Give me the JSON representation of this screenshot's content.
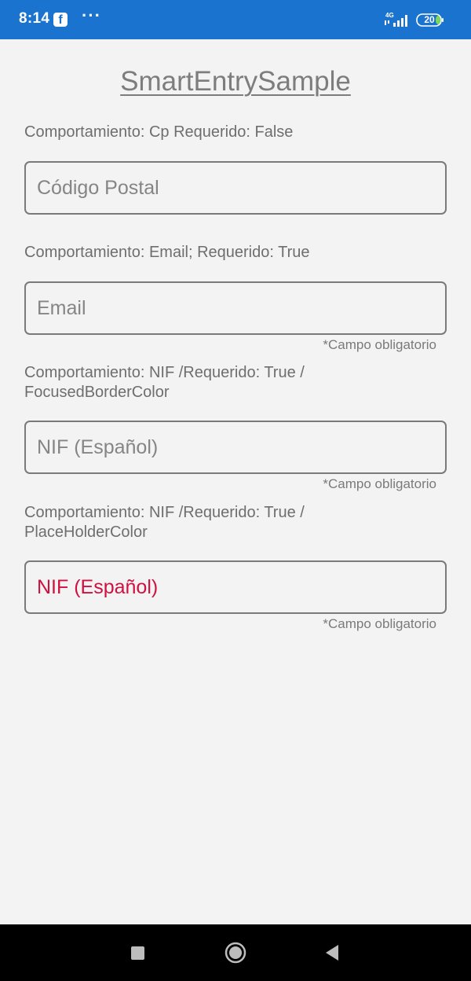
{
  "status_bar": {
    "time": "8:14",
    "notification_icons": [
      "facebook-icon",
      "more-dots-icon"
    ],
    "network": "4G",
    "battery_level": "20",
    "colors": {
      "background": "#1a74cf",
      "battery_fill": "#7ed957"
    }
  },
  "page": {
    "title": "SmartEntrySample"
  },
  "fields": [
    {
      "behavior_label": "Comportamiento: Cp Requerido: False",
      "placeholder": "Código Postal",
      "required_hint": ""
    },
    {
      "behavior_label": "Comportamiento: Email; Requerido: True",
      "placeholder": "Email",
      "required_hint": "*Campo obligatorio"
    },
    {
      "behavior_label": "Comportamiento: NIF /Requerido: True / FocusedBorderColor",
      "placeholder": "NIF (Español)",
      "required_hint": "*Campo obligatorio"
    },
    {
      "behavior_label": "Comportamiento: NIF /Requerido: True / PlaceHolderColor",
      "placeholder": "NIF (Español)",
      "placeholder_color": "#d01040",
      "required_hint": "*Campo obligatorio"
    }
  ],
  "nav_bar": {
    "buttons": [
      "recents-square-icon",
      "home-circle-icon",
      "back-triangle-icon"
    ]
  }
}
